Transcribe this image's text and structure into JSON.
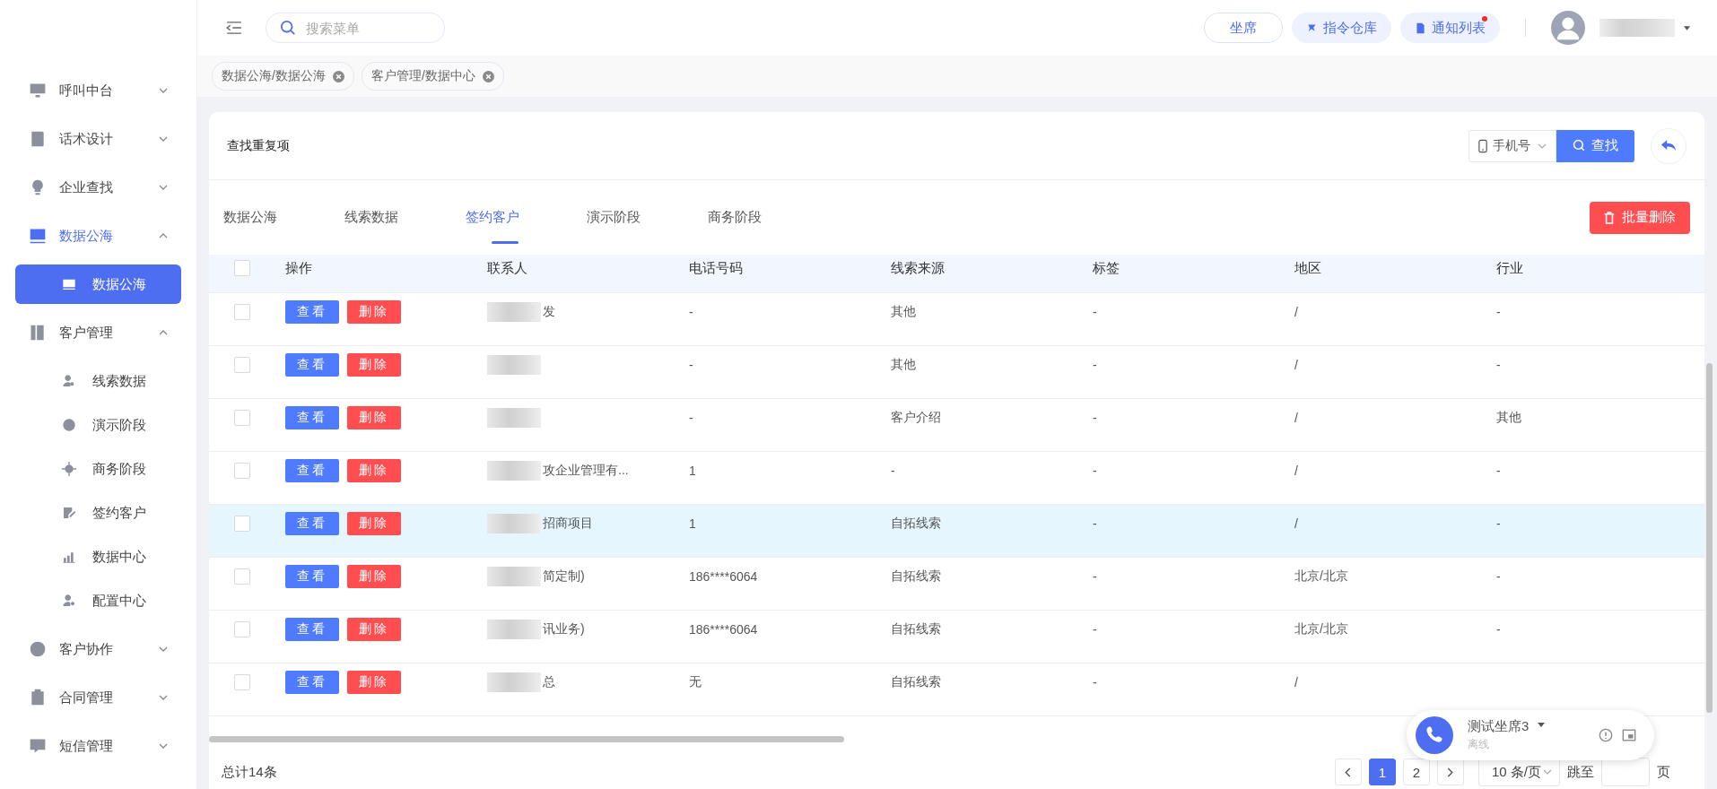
{
  "sidebar": {
    "items": [
      {
        "label": "呼叫中台",
        "selected": false,
        "expanded": false
      },
      {
        "label": "话术设计",
        "selected": false,
        "expanded": false
      },
      {
        "label": "企业查找",
        "selected": false,
        "expanded": false
      },
      {
        "label": "数据公海",
        "selected": true,
        "expanded": true,
        "children": [
          {
            "label": "数据公海",
            "selected": true
          }
        ]
      },
      {
        "label": "客户管理",
        "selected": false,
        "expanded": true,
        "children": [
          {
            "label": "线索数据",
            "selected": false
          },
          {
            "label": "演示阶段",
            "selected": false
          },
          {
            "label": "商务阶段",
            "selected": false
          },
          {
            "label": "签约客户",
            "selected": false
          },
          {
            "label": "数据中心",
            "selected": false
          },
          {
            "label": "配置中心",
            "selected": false
          }
        ]
      },
      {
        "label": "客户协作",
        "selected": false,
        "expanded": false
      },
      {
        "label": "合同管理",
        "selected": false,
        "expanded": false
      },
      {
        "label": "短信管理",
        "selected": false,
        "expanded": false
      }
    ]
  },
  "header": {
    "search": {
      "placeholder": "搜索菜单"
    },
    "buttons": [
      {
        "label": "坐席",
        "kind": "outline",
        "badge": false
      },
      {
        "label": "指令仓库",
        "kind": "tinted",
        "badge": false
      },
      {
        "label": "通知列表",
        "kind": "tinted",
        "badge": true
      }
    ]
  },
  "open_tabs": [
    {
      "label": "数据公海/数据公海"
    },
    {
      "label": "客户管理/数据中心"
    }
  ],
  "card": {
    "title": "查找重复项",
    "field_select": "手机号",
    "search_button": "查找",
    "tabs": [
      {
        "label": "数据公海",
        "selected": false
      },
      {
        "label": "线索数据",
        "selected": false
      },
      {
        "label": "签约客户",
        "selected": true
      },
      {
        "label": "演示阶段",
        "selected": false
      },
      {
        "label": "商务阶段",
        "selected": false
      }
    ],
    "batch_delete": "批量删除"
  },
  "table": {
    "all_checked": false,
    "columns": [
      "操作",
      "联系人",
      "电话号码",
      "线索来源",
      "标签",
      "地区",
      "行业"
    ],
    "rows": [
      {
        "checked": false,
        "highlighted": false,
        "actions": [
          "查看",
          "删除"
        ],
        "contact": "发",
        "phone": "-",
        "source": "其他",
        "tag": "-",
        "region": "/",
        "industry": "-"
      },
      {
        "checked": false,
        "highlighted": false,
        "actions": [
          "查看",
          "删除"
        ],
        "contact": "",
        "phone": "-",
        "source": "其他",
        "tag": "-",
        "region": "/",
        "industry": "-"
      },
      {
        "checked": false,
        "highlighted": false,
        "actions": [
          "查看",
          "删除"
        ],
        "contact": "",
        "phone": "-",
        "source": "客户介绍",
        "tag": "-",
        "region": "/",
        "industry": "其他"
      },
      {
        "checked": false,
        "highlighted": false,
        "actions": [
          "查看",
          "删除"
        ],
        "contact": "攻企业管理有...",
        "phone": "1",
        "source": "-",
        "tag": "-",
        "region": "/",
        "industry": "-"
      },
      {
        "checked": false,
        "highlighted": true,
        "actions": [
          "查看",
          "删除"
        ],
        "contact": "招商项目",
        "phone": "1",
        "source": "自拓线索",
        "tag": "-",
        "region": "/",
        "industry": "-"
      },
      {
        "checked": false,
        "highlighted": false,
        "actions": [
          "查看",
          "删除"
        ],
        "contact": "简定制)",
        "phone": "186****6064",
        "source": "自拓线索",
        "tag": "-",
        "region": "北京/北京",
        "industry": "-"
      },
      {
        "checked": false,
        "highlighted": false,
        "actions": [
          "查看",
          "删除"
        ],
        "contact": "讯业务)",
        "phone": "186****6064",
        "source": "自拓线索",
        "tag": "-",
        "region": "北京/北京",
        "industry": "-"
      },
      {
        "checked": false,
        "highlighted": false,
        "actions": [
          "查看",
          "删除"
        ],
        "contact": "总",
        "phone": "无",
        "source": "自拓线索",
        "tag": "-",
        "region": "/",
        "industry": ""
      }
    ]
  },
  "footer": {
    "total": "总计14条",
    "pages": [
      {
        "label": "1",
        "selected": true
      },
      {
        "label": "2",
        "selected": false
      }
    ],
    "page_size": "10 条/页",
    "goto": "跳至",
    "page_unit": "页"
  },
  "call_widget": {
    "name": "测试坐席3",
    "status": "离线"
  }
}
